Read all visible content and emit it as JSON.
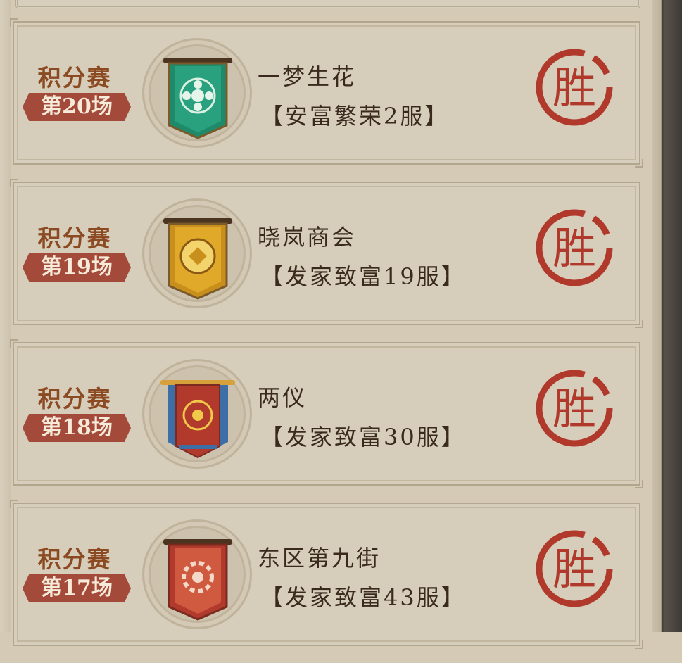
{
  "matches": [
    {
      "mode": "积分赛",
      "round": "第20场",
      "guild": "一梦生花",
      "server": "【安富繁荣2服】",
      "banner_color": "green",
      "result": "胜"
    },
    {
      "mode": "积分赛",
      "round": "第19场",
      "guild": "晓岚商会",
      "server": "【发家致富19服】",
      "banner_color": "gold",
      "result": "胜"
    },
    {
      "mode": "积分赛",
      "round": "第18场",
      "guild": "两仪",
      "server": "【发家致富30服】",
      "banner_color": "red-blue",
      "result": "胜"
    },
    {
      "mode": "积分赛",
      "round": "第17场",
      "guild": "东区第九街",
      "server": "【发家致富43服】",
      "banner_color": "red",
      "result": "胜"
    }
  ],
  "colors": {
    "panel": "#d6cdba",
    "mode_text": "#8c4a22",
    "round_tag": "#a34a3a",
    "seal": "#b0392b",
    "green_banner": "#1f8a6a",
    "gold_banner": "#c98f1c",
    "red_banner": "#b23a2c"
  }
}
